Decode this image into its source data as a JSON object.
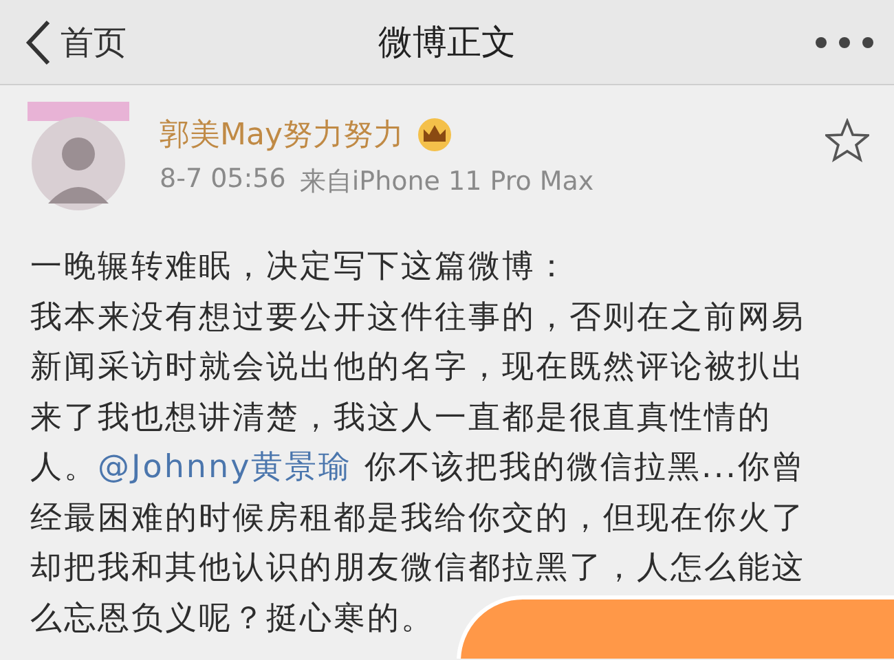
{
  "nav_bar": {
    "back_label": "首页",
    "title": "微博正文"
  },
  "post": {
    "author": "郭美May努力努力",
    "vip": true,
    "starred": false,
    "time": "8-7 05:56",
    "source": "来自iPhone 11 Pro Max",
    "lines": [
      [
        {
          "kind": "text",
          "text": "一晚辗转难眠，决定写下这篇微博："
        }
      ],
      [
        {
          "kind": "text",
          "text": "我本来没有想过要公开这件往事的，否则在之前网易"
        }
      ],
      [
        {
          "kind": "text",
          "text": "新闻采访时就会说出他的名字，现在既然评论被扒出"
        }
      ],
      [
        {
          "kind": "text",
          "text": "来了我也想讲清楚，我这人一直都是很直真性情的"
        }
      ],
      [
        {
          "kind": "text",
          "text": "人。"
        },
        {
          "kind": "mention",
          "text": "@Johnny黄景瑜"
        },
        {
          "kind": "text",
          "text": " 你不该把我的微信拉黑...你曾"
        }
      ],
      [
        {
          "kind": "text",
          "text": "经最困难的时候房租都是我给你交的，但现在你火了"
        }
      ],
      [
        {
          "kind": "text",
          "text": "却把我和其他认识的朋友微信都拉黑了，人怎么能这"
        }
      ],
      [
        {
          "kind": "text",
          "text": "么忘恩负义呢？挺心寒的。"
        }
      ]
    ]
  }
}
